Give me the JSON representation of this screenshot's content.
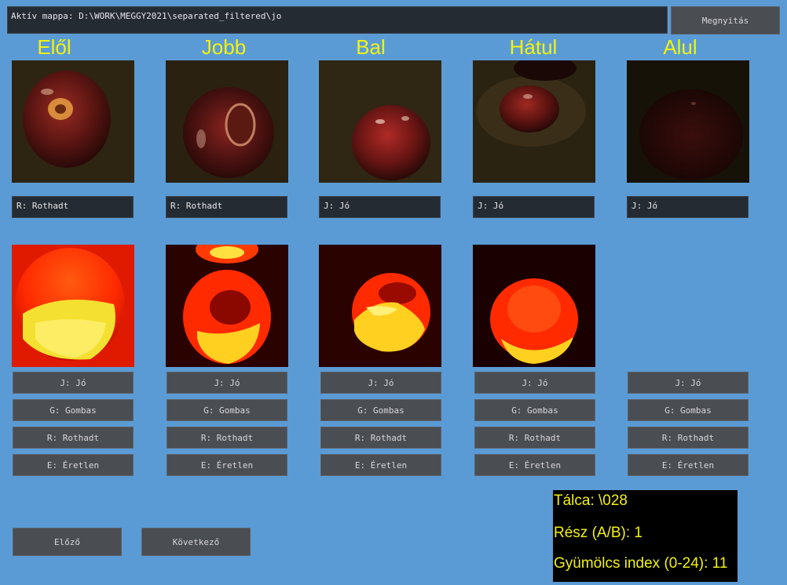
{
  "header": {
    "path_text": "Aktív mappa: D:\\WORK\\MEGGY2021\\separated_filtered\\jo",
    "open_button": "Megnyitás"
  },
  "views": [
    {
      "title": "Elől",
      "label": "R: Rothadt"
    },
    {
      "title": "Jobb",
      "label": "R: Rothadt"
    },
    {
      "title": "Bal",
      "label": "J: Jó"
    },
    {
      "title": "Hátul",
      "label": "J: Jó"
    },
    {
      "title": "Alul",
      "label": "J: Jó"
    }
  ],
  "class_buttons": [
    "J: Jó",
    "G: Gombas",
    "R: Rothadt",
    "E: Éretlen"
  ],
  "navigation": {
    "prev": "Előző",
    "next": "Következő"
  },
  "info": {
    "tray": "Tálca: \\028",
    "part": "Rész (A/B): 1",
    "index": "Gyümölcs index (0-24): 11"
  }
}
